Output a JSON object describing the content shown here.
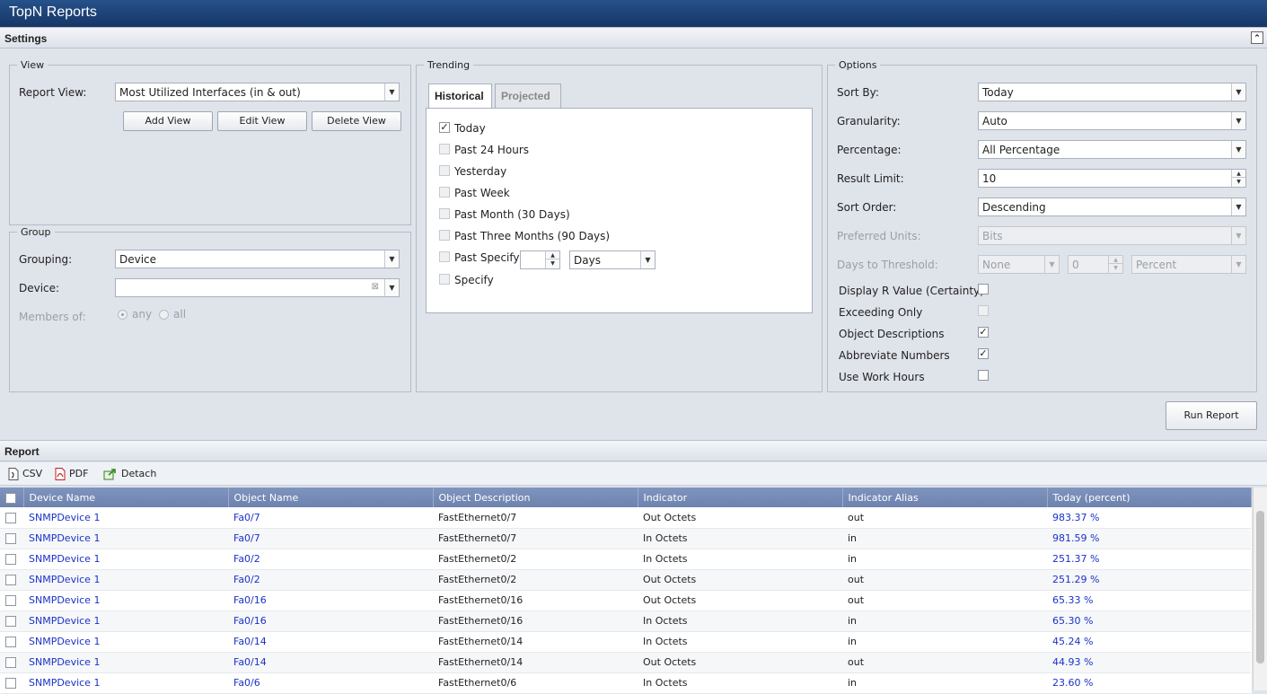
{
  "app": {
    "title": "TopN Reports"
  },
  "settings": {
    "title": "Settings",
    "view": {
      "legend": "View",
      "report_view_label": "Report View:",
      "report_view_value": "Most Utilized Interfaces (in & out)",
      "add_view": "Add View",
      "edit_view": "Edit View",
      "delete_view": "Delete View"
    },
    "group": {
      "legend": "Group",
      "grouping_label": "Grouping:",
      "grouping_value": "Device",
      "device_label": "Device:",
      "device_value": "",
      "members_label": "Members of:",
      "any": "any",
      "all": "all"
    },
    "trending": {
      "legend": "Trending",
      "tabs": [
        "Historical",
        "Projected"
      ],
      "active_tab": "Historical",
      "options": [
        {
          "label": "Today",
          "checked": true
        },
        {
          "label": "Past 24 Hours",
          "checked": false
        },
        {
          "label": "Yesterday",
          "checked": false
        },
        {
          "label": "Past Week",
          "checked": false
        },
        {
          "label": "Past Month (30 Days)",
          "checked": false
        },
        {
          "label": "Past Three Months (90 Days)",
          "checked": false
        },
        {
          "label": "Past Specify",
          "checked": false
        },
        {
          "label": "Specify",
          "checked": false
        }
      ],
      "specify_number": "",
      "specify_unit": "Days"
    },
    "options": {
      "legend": "Options",
      "sort_by_label": "Sort By:",
      "sort_by_value": "Today",
      "granularity_label": "Granularity:",
      "granularity_value": "Auto",
      "percentage_label": "Percentage:",
      "percentage_value": "All Percentage",
      "result_limit_label": "Result Limit:",
      "result_limit_value": "10",
      "sort_order_label": "Sort Order:",
      "sort_order_value": "Descending",
      "preferred_units_label": "Preferred Units:",
      "preferred_units_value": "Bits",
      "days_threshold_label": "Days to Threshold:",
      "days_threshold_value": "None",
      "days_threshold_number": "0",
      "days_threshold_unit": "Percent",
      "display_r_label": "Display R Value (Certainty)",
      "exceeding_only_label": "Exceeding Only",
      "object_desc_label": "Object Descriptions",
      "abbreviate_label": "Abbreviate Numbers",
      "work_hours_label": "Use Work Hours"
    },
    "run_report": "Run Report"
  },
  "report": {
    "title": "Report",
    "toolbar": {
      "csv": "CSV",
      "pdf": "PDF",
      "detach": "Detach"
    },
    "columns": [
      "Device Name",
      "Object Name",
      "Object Description",
      "Indicator",
      "Indicator Alias",
      "Today (percent)"
    ],
    "rows": [
      [
        "SNMPDevice 1",
        "Fa0/7",
        "FastEthernet0/7",
        "Out Octets",
        "out",
        "983.37 %"
      ],
      [
        "SNMPDevice 1",
        "Fa0/7",
        "FastEthernet0/7",
        "In Octets",
        "in",
        "981.59 %"
      ],
      [
        "SNMPDevice 1",
        "Fa0/2",
        "FastEthernet0/2",
        "In Octets",
        "in",
        "251.37 %"
      ],
      [
        "SNMPDevice 1",
        "Fa0/2",
        "FastEthernet0/2",
        "Out Octets",
        "out",
        "251.29 %"
      ],
      [
        "SNMPDevice 1",
        "Fa0/16",
        "FastEthernet0/16",
        "Out Octets",
        "out",
        "65.33 %"
      ],
      [
        "SNMPDevice 1",
        "Fa0/16",
        "FastEthernet0/16",
        "In Octets",
        "in",
        "65.30 %"
      ],
      [
        "SNMPDevice 1",
        "Fa0/14",
        "FastEthernet0/14",
        "In Octets",
        "in",
        "45.24 %"
      ],
      [
        "SNMPDevice 1",
        "Fa0/14",
        "FastEthernet0/14",
        "Out Octets",
        "out",
        "44.93 %"
      ],
      [
        "SNMPDevice 1",
        "Fa0/6",
        "FastEthernet0/6",
        "In Octets",
        "in",
        "23.60 %"
      ]
    ]
  }
}
